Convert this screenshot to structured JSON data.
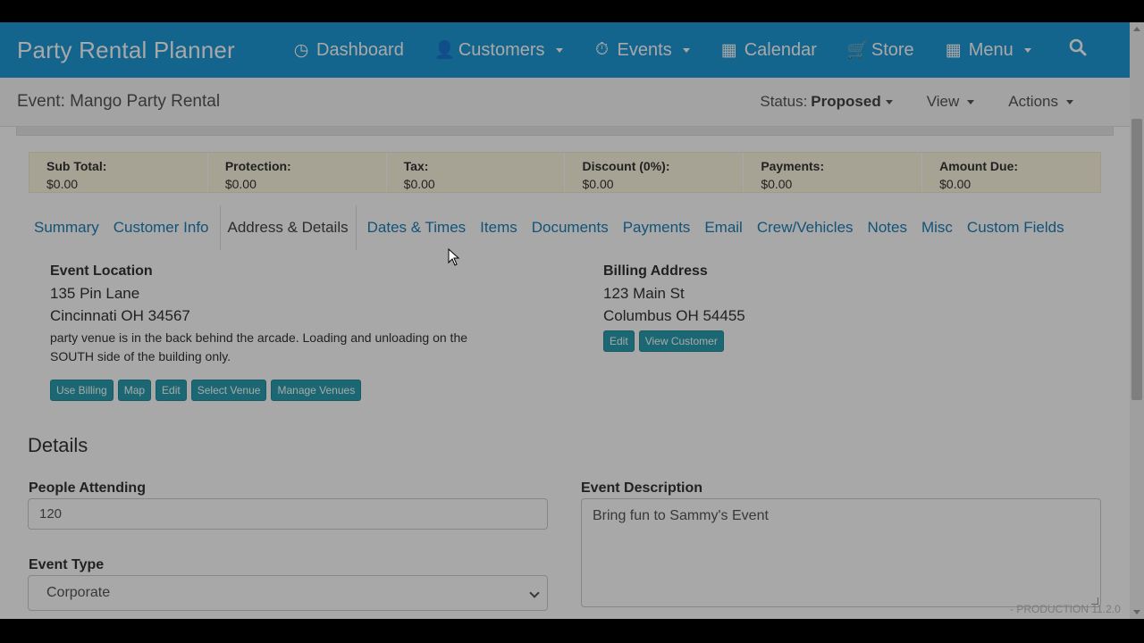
{
  "nav": {
    "brand": "Party Rental Planner",
    "items": [
      {
        "label": "Dashboard",
        "icon": "dashboard-icon",
        "glyph": "◷",
        "dropdown": false
      },
      {
        "label": "Customers",
        "icon": "user-icon",
        "glyph": "👤",
        "dropdown": true
      },
      {
        "label": "Events",
        "icon": "clock-icon",
        "glyph": "⏱",
        "dropdown": true
      },
      {
        "label": "Calendar",
        "icon": "calendar-icon",
        "glyph": "▦",
        "dropdown": false
      },
      {
        "label": "Store",
        "icon": "cart-icon",
        "glyph": "🛒",
        "dropdown": false
      },
      {
        "label": "Menu",
        "icon": "grid-icon",
        "glyph": "▦",
        "dropdown": true
      }
    ],
    "search_glyph": "⌕"
  },
  "subheader": {
    "title": "Event: Mango Party Rental",
    "status_label": "Status:",
    "status_value": "Proposed",
    "view": "View",
    "actions": "Actions"
  },
  "totals": [
    {
      "label": "Sub Total:",
      "value": "$0.00"
    },
    {
      "label": "Protection:",
      "value": "$0.00"
    },
    {
      "label": "Tax:",
      "value": "$0.00"
    },
    {
      "label": "Discount (0%):",
      "value": "$0.00"
    },
    {
      "label": "Payments:",
      "value": "$0.00"
    },
    {
      "label": "Amount Due:",
      "value": "$0.00"
    }
  ],
  "tabs": [
    "Summary",
    "Customer Info",
    "Address & Details",
    "Dates & Times",
    "Items",
    "Documents",
    "Payments",
    "Email",
    "Crew/Vehicles",
    "Notes",
    "Misc",
    "Custom Fields"
  ],
  "active_tab": "Address & Details",
  "event_location": {
    "heading": "Event Location",
    "line1": "135 Pin Lane",
    "line2": "Cincinnati OH 34567",
    "note": "party venue is in the back behind the arcade. Loading and unloading on the SOUTH side of the building only.",
    "buttons": [
      "Use Billing",
      "Map",
      "Edit",
      "Select Venue",
      "Manage Venues"
    ]
  },
  "billing_address": {
    "heading": "Billing Address",
    "line1": "123 Main St",
    "line2": "Columbus OH 54455",
    "buttons": [
      "Edit",
      "View Customer"
    ]
  },
  "details": {
    "heading": "Details",
    "people_label": "People Attending",
    "people_value": "120",
    "type_label": "Event Type",
    "type_value": "Corporate",
    "desc_label": "Event Description",
    "desc_value": "Bring fun to Sammy's Event"
  },
  "footer": {
    "version": "- PRODUCTION 11.2.0"
  },
  "colors": {
    "navbar": "#1d9ad6",
    "link": "#1d7fb5",
    "button": "#2a9fb0",
    "totals_bg": "#fcf8e3"
  }
}
